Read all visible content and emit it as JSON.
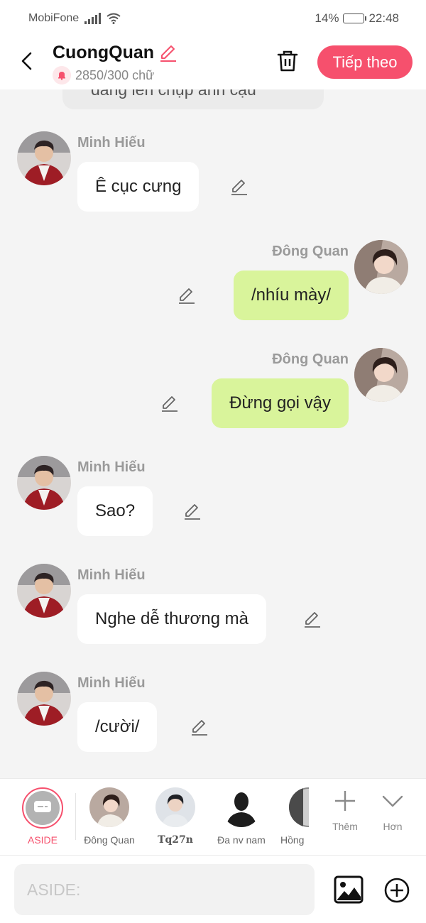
{
  "status_bar": {
    "carrier": "MobiFone",
    "battery_percent": "14%",
    "battery_level": 0.14,
    "time": "22:48"
  },
  "header": {
    "title": "CuongQuan",
    "word_count": "2850/300 chữ",
    "next_label": "Tiếp theo",
    "accent_color": "#f6506d"
  },
  "chat": {
    "previous_text": "đang lén chụp ảnh cậu",
    "messages": [
      {
        "sender": "Minh Hiếu",
        "text": "Ê cục cưng",
        "side": "left"
      },
      {
        "sender": "Đông Quan",
        "text": "/nhíu mày/",
        "side": "right"
      },
      {
        "sender": "Đông Quan",
        "text": "Đừng gọi vậy",
        "side": "right"
      },
      {
        "sender": "Minh Hiếu",
        "text": "Sao?",
        "side": "left"
      },
      {
        "sender": "Minh Hiếu",
        "text": "Nghe dễ thương mà",
        "side": "left"
      },
      {
        "sender": "Minh Hiếu",
        "text": "/cười/",
        "side": "left"
      }
    ]
  },
  "characters": {
    "items": [
      {
        "label": "ASIDE",
        "selected": true
      },
      {
        "label": "Đông Quan"
      },
      {
        "label": "Tq27n"
      },
      {
        "label": "Đa nv nam"
      },
      {
        "label": "Hồng"
      }
    ],
    "add_label": "Thêm",
    "more_label": "Hơn"
  },
  "input": {
    "placeholder": "ASIDE:"
  }
}
